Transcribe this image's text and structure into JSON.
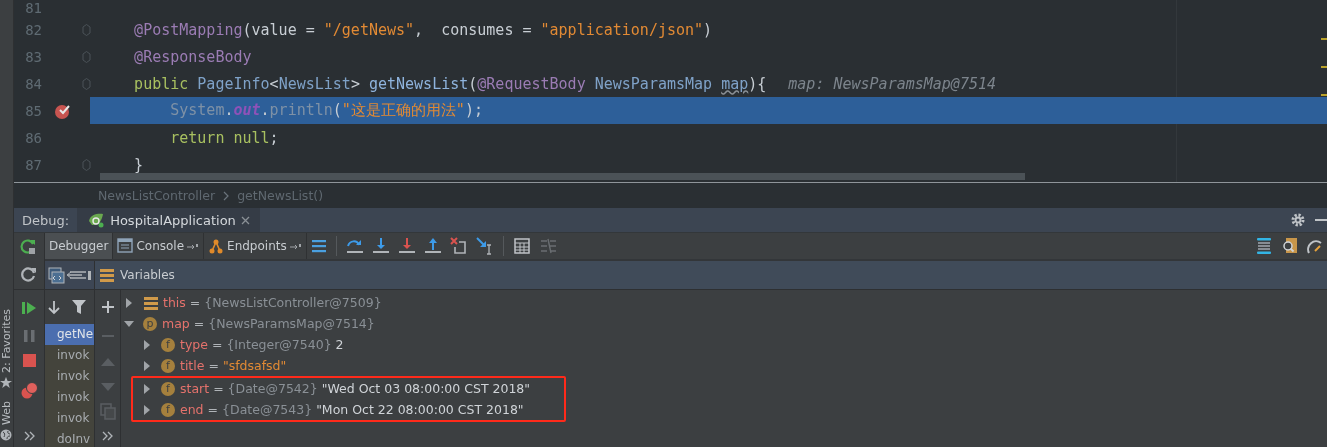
{
  "editor": {
    "lines": [
      {
        "number": "81",
        "fold": false,
        "breakpoint": false,
        "current": false
      },
      {
        "number": "82",
        "fold": true,
        "breakpoint": false,
        "current": false,
        "tokens": [
          {
            "text": "    @PostMapping",
            "kind": "annotation"
          },
          {
            "text": "(value = ",
            "kind": "plain"
          },
          {
            "text": "\"/getNews\"",
            "kind": "string"
          },
          {
            "text": ",  consumes = ",
            "kind": "plain"
          },
          {
            "text": "\"application/json\"",
            "kind": "string"
          },
          {
            "text": ")",
            "kind": "plain"
          }
        ]
      },
      {
        "number": "83",
        "fold": true,
        "breakpoint": false,
        "current": false,
        "tokens": [
          {
            "text": "    @ResponseBody",
            "kind": "annotation"
          }
        ]
      },
      {
        "number": "84",
        "fold": true,
        "breakpoint": false,
        "current": false,
        "hint": "map: NewsParamsMap@7514",
        "tokens": [
          {
            "text": "    public ",
            "kind": "keyword"
          },
          {
            "text": "PageInfo",
            "kind": "type"
          },
          {
            "text": "<",
            "kind": "plain"
          },
          {
            "text": "NewsList",
            "kind": "type"
          },
          {
            "text": "> ",
            "kind": "plain"
          },
          {
            "text": "getNewsList",
            "kind": "method"
          },
          {
            "text": "(",
            "kind": "plain"
          },
          {
            "text": "@RequestBody ",
            "kind": "annotation"
          },
          {
            "text": "NewsParamsMap ",
            "kind": "type"
          },
          {
            "text": "map",
            "kind": "param"
          },
          {
            "text": "){",
            "kind": "plain"
          }
        ]
      },
      {
        "number": "85",
        "fold": false,
        "breakpoint": true,
        "current": true,
        "tokens": [
          {
            "text": "        System",
            "kind": "dim"
          },
          {
            "text": ".",
            "kind": "plain"
          },
          {
            "text": "out",
            "kind": "field"
          },
          {
            "text": ".",
            "kind": "plain"
          },
          {
            "text": "println",
            "kind": "dim"
          },
          {
            "text": "(",
            "kind": "plain"
          },
          {
            "text": "\"这是正确的用法\"",
            "kind": "string"
          },
          {
            "text": ");",
            "kind": "plain"
          }
        ]
      },
      {
        "number": "86",
        "fold": false,
        "breakpoint": false,
        "current": false,
        "tokens": [
          {
            "text": "        return null",
            "kind": "keyword"
          },
          {
            "text": ";",
            "kind": "plain"
          }
        ]
      },
      {
        "number": "87",
        "fold": true,
        "breakpoint": false,
        "current": false,
        "tokens": [
          {
            "text": "    }",
            "kind": "plain"
          }
        ]
      }
    ]
  },
  "breadcrumb": [
    "NewsListController",
    "getNewsList()"
  ],
  "debug_bar": {
    "label": "Debug:",
    "tabs": [
      {
        "label": "HospitalApplication",
        "selected": true
      }
    ]
  },
  "debugger_tabs": [
    {
      "label": "Debugger",
      "kind": "debugger",
      "selected": true
    },
    {
      "label": "Console",
      "kind": "console",
      "selected": false
    },
    {
      "label": "Endpoints",
      "kind": "endpoints",
      "selected": false
    }
  ],
  "frames": [
    {
      "label": "getNe",
      "selected": true
    },
    {
      "label": "invok",
      "selected": false
    },
    {
      "label": "invok",
      "selected": false
    },
    {
      "label": "invok",
      "selected": false
    },
    {
      "label": "invok",
      "selected": false
    },
    {
      "label": "doInv",
      "selected": false
    }
  ],
  "variables": {
    "title": "Variables",
    "items": [
      {
        "name": "this",
        "operator": "=",
        "kind": "object",
        "ref": "{NewsListController@7509}",
        "expanded": false,
        "highlighted": false
      },
      {
        "name": "map",
        "operator": "=",
        "kind": "parameter",
        "badge": "p",
        "ref": "{NewsParamsMap@7514}",
        "expanded": true,
        "highlighted": false,
        "children": [
          {
            "name": "type",
            "operator": "=",
            "kind": "field",
            "badge": "f",
            "ref": "{Integer@7540}",
            "value": "2",
            "string_literal": false,
            "expanded": false,
            "highlighted": false
          },
          {
            "name": "title",
            "operator": "=",
            "kind": "field",
            "badge": "f",
            "value": "\"sfdsafsd\"",
            "string_literal": true,
            "expanded": false,
            "highlighted": false
          },
          {
            "name": "start",
            "operator": "=",
            "kind": "field",
            "badge": "f",
            "ref": "{Date@7542}",
            "value": "\"Wed Oct 03 08:00:00 CST 2018\"",
            "string_literal": false,
            "expanded": false,
            "highlighted": true
          },
          {
            "name": "end",
            "operator": "=",
            "kind": "field",
            "badge": "f",
            "ref": "{Date@7543}",
            "value": "\"Mon Oct 22 08:00:00 CST 2018\"",
            "string_literal": false,
            "expanded": false,
            "highlighted": true
          }
        ]
      }
    ]
  },
  "sidebar_tabs": [
    {
      "label": "2: Favorites",
      "kind": "favorites"
    },
    {
      "label": "Web",
      "kind": "web"
    }
  ]
}
